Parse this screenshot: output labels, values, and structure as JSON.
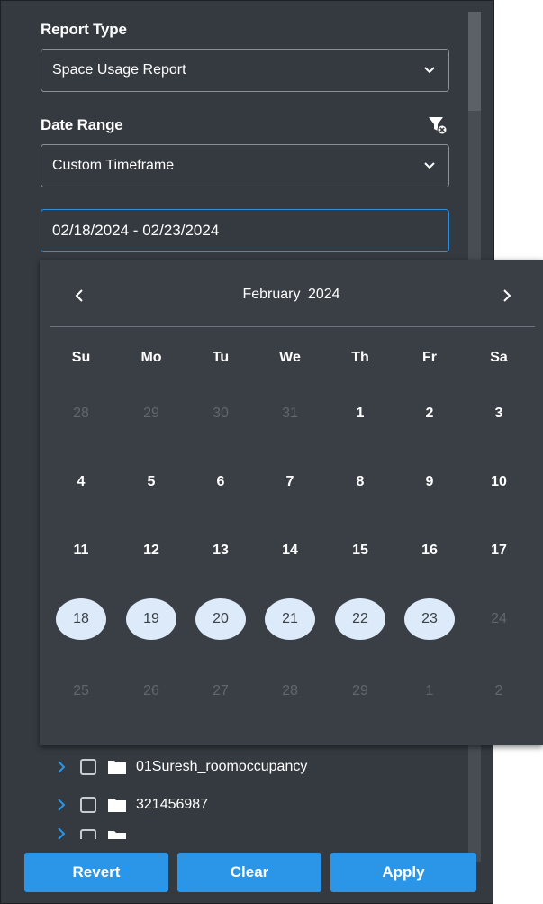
{
  "report_type": {
    "label": "Report Type",
    "value": "Space Usage Report"
  },
  "date_range": {
    "label": "Date Range",
    "value": "Custom Timeframe",
    "range_input": "02/18/2024 - 02/23/2024"
  },
  "calendar": {
    "title": "February  2024",
    "weekdays": [
      "Su",
      "Mo",
      "Tu",
      "We",
      "Th",
      "Fr",
      "Sa"
    ],
    "weeks": [
      [
        "28",
        "29",
        "30",
        "31",
        "1",
        "2",
        "3"
      ],
      [
        "4",
        "5",
        "6",
        "7",
        "8",
        "9",
        "10"
      ],
      [
        "11",
        "12",
        "13",
        "14",
        "15",
        "16",
        "17"
      ],
      [
        "18",
        "19",
        "20",
        "21",
        "22",
        "23",
        "24"
      ],
      [
        "25",
        "26",
        "27",
        "28",
        "29",
        "1",
        "2"
      ]
    ],
    "muted": [
      [
        true,
        true,
        true,
        true,
        false,
        false,
        false
      ],
      [
        false,
        false,
        false,
        false,
        false,
        false,
        false
      ],
      [
        false,
        false,
        false,
        false,
        false,
        false,
        false
      ],
      [
        false,
        false,
        false,
        false,
        false,
        false,
        true
      ],
      [
        true,
        true,
        true,
        true,
        true,
        true,
        true
      ]
    ],
    "selected_range": [
      "18",
      "23"
    ]
  },
  "tree": {
    "items": [
      {
        "label": "01Suresh_roomoccupancy"
      },
      {
        "label": "321456987"
      }
    ]
  },
  "buttons": {
    "revert": "Revert",
    "clear": "Clear",
    "apply": "Apply"
  },
  "colors": {
    "panel_bg": "#343a40",
    "accent": "#2b95e8",
    "selected_day_bg": "#ddeafa"
  }
}
